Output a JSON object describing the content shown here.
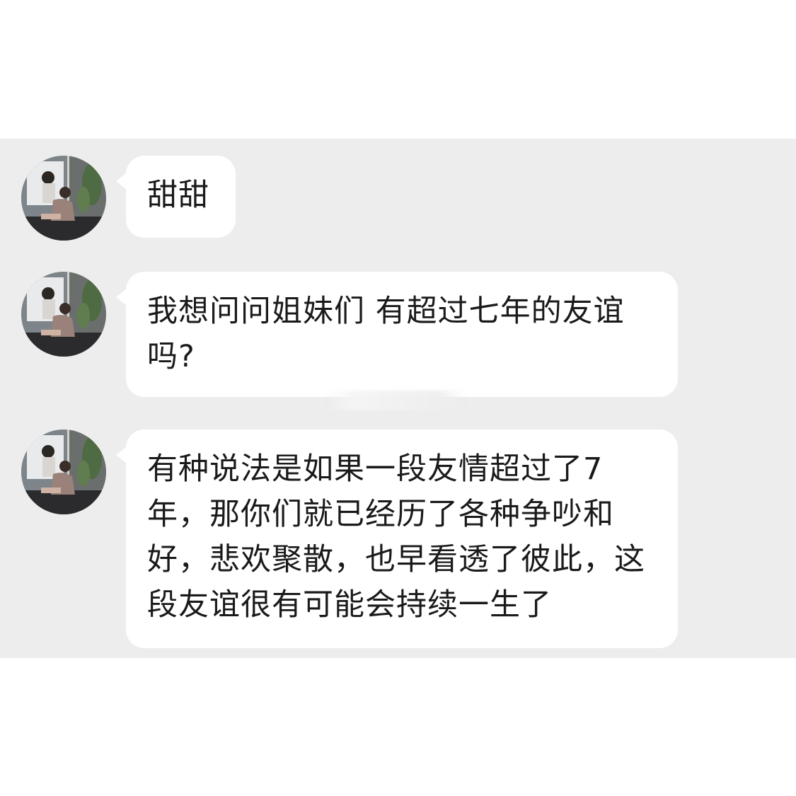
{
  "chat": {
    "messages": [
      {
        "sender": "avatar",
        "text": "甜甜"
      },
      {
        "sender": "avatar",
        "text": "我想问问姐妹们 有超过七年的友谊吗?"
      },
      {
        "sender": "avatar",
        "text": "有种说法是如果一段友情超过了7年，那你们就已经历了各种争吵和好，悲欢聚散，也早看透了彼此，这段友谊很有可能会持续一生了"
      }
    ]
  },
  "colors": {
    "page_background": "#ffffff",
    "chat_background": "#ededed",
    "bubble_background": "#ffffff",
    "text": "#1a1a1a"
  }
}
